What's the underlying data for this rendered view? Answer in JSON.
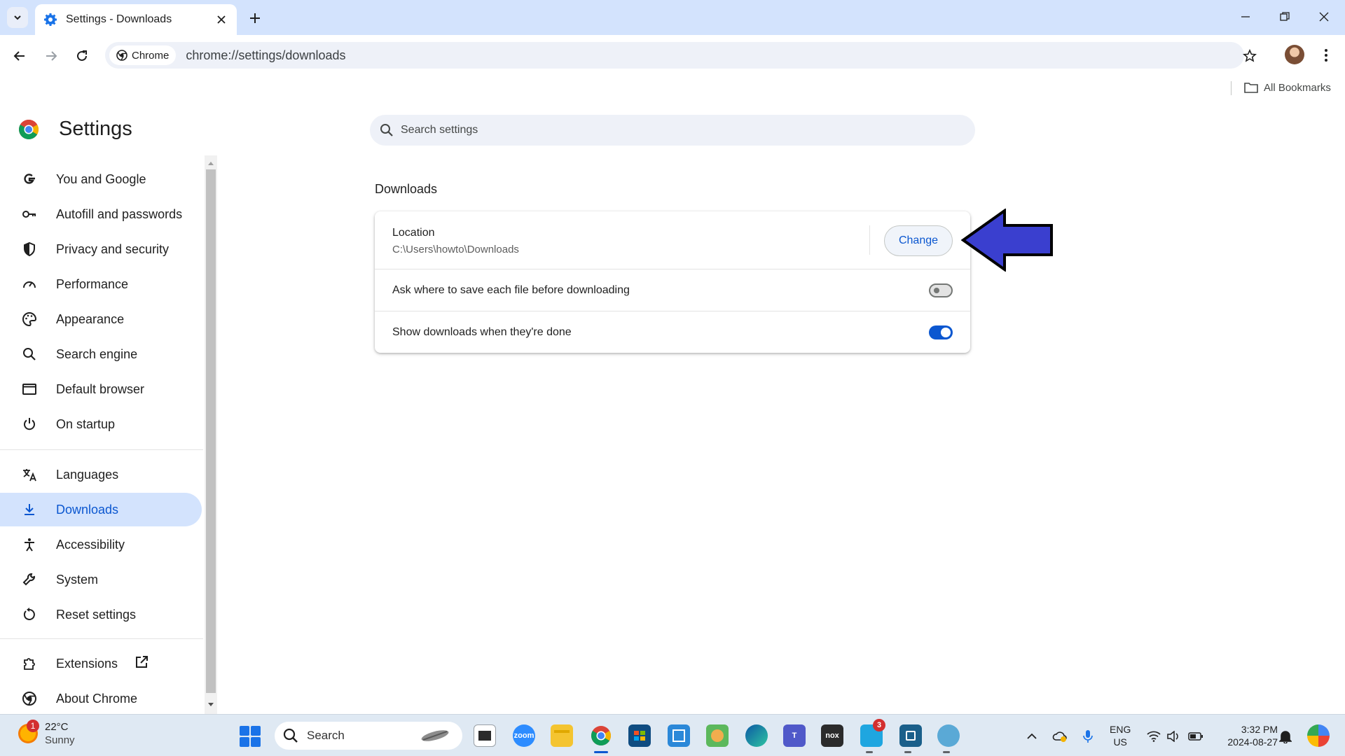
{
  "tab": {
    "title": "Settings - Downloads"
  },
  "omnibox": {
    "chip_label": "Chrome",
    "url": "chrome://settings/downloads"
  },
  "bookmarks": {
    "all_bookmarks": "All Bookmarks"
  },
  "header": {
    "title": "Settings",
    "search_placeholder": "Search settings"
  },
  "sidebar": {
    "items": [
      {
        "label": "You and Google",
        "icon": "google-g-icon"
      },
      {
        "label": "Autofill and passwords",
        "icon": "key-icon"
      },
      {
        "label": "Privacy and security",
        "icon": "shield-icon"
      },
      {
        "label": "Performance",
        "icon": "speedometer-icon"
      },
      {
        "label": "Appearance",
        "icon": "palette-icon"
      },
      {
        "label": "Search engine",
        "icon": "search-icon"
      },
      {
        "label": "Default browser",
        "icon": "browser-window-icon"
      },
      {
        "label": "On startup",
        "icon": "power-icon"
      },
      {
        "label": "Languages",
        "icon": "translate-icon"
      },
      {
        "label": "Downloads",
        "icon": "download-icon",
        "active": true
      },
      {
        "label": "Accessibility",
        "icon": "accessibility-icon"
      },
      {
        "label": "System",
        "icon": "wrench-icon"
      },
      {
        "label": "Reset settings",
        "icon": "reset-icon"
      },
      {
        "label": "Extensions",
        "icon": "puzzle-icon"
      },
      {
        "label": "About Chrome",
        "icon": "chrome-icon"
      }
    ]
  },
  "downloads": {
    "section_title": "Downloads",
    "location_label": "Location",
    "location_value": "C:\\Users\\howto\\Downloads",
    "change_label": "Change",
    "ask_label": "Ask where to save each file before downloading",
    "ask_enabled": false,
    "show_label": "Show downloads when they're done",
    "show_enabled": true
  },
  "taskbar": {
    "weather_badge": "1",
    "weather_temp": "22°C",
    "weather_condition": "Sunny",
    "search_label": "Search",
    "zoom_label": "zoom",
    "nox_label": "nox",
    "badge_count": "3",
    "lang_1": "ENG",
    "lang_2": "US",
    "time": "3:32 PM",
    "date": "2024-08-27"
  },
  "colors": {
    "accent": "#0b57d0",
    "tabstrip": "#d3e3fd",
    "annotation_arrow": "#3a3fcf"
  }
}
